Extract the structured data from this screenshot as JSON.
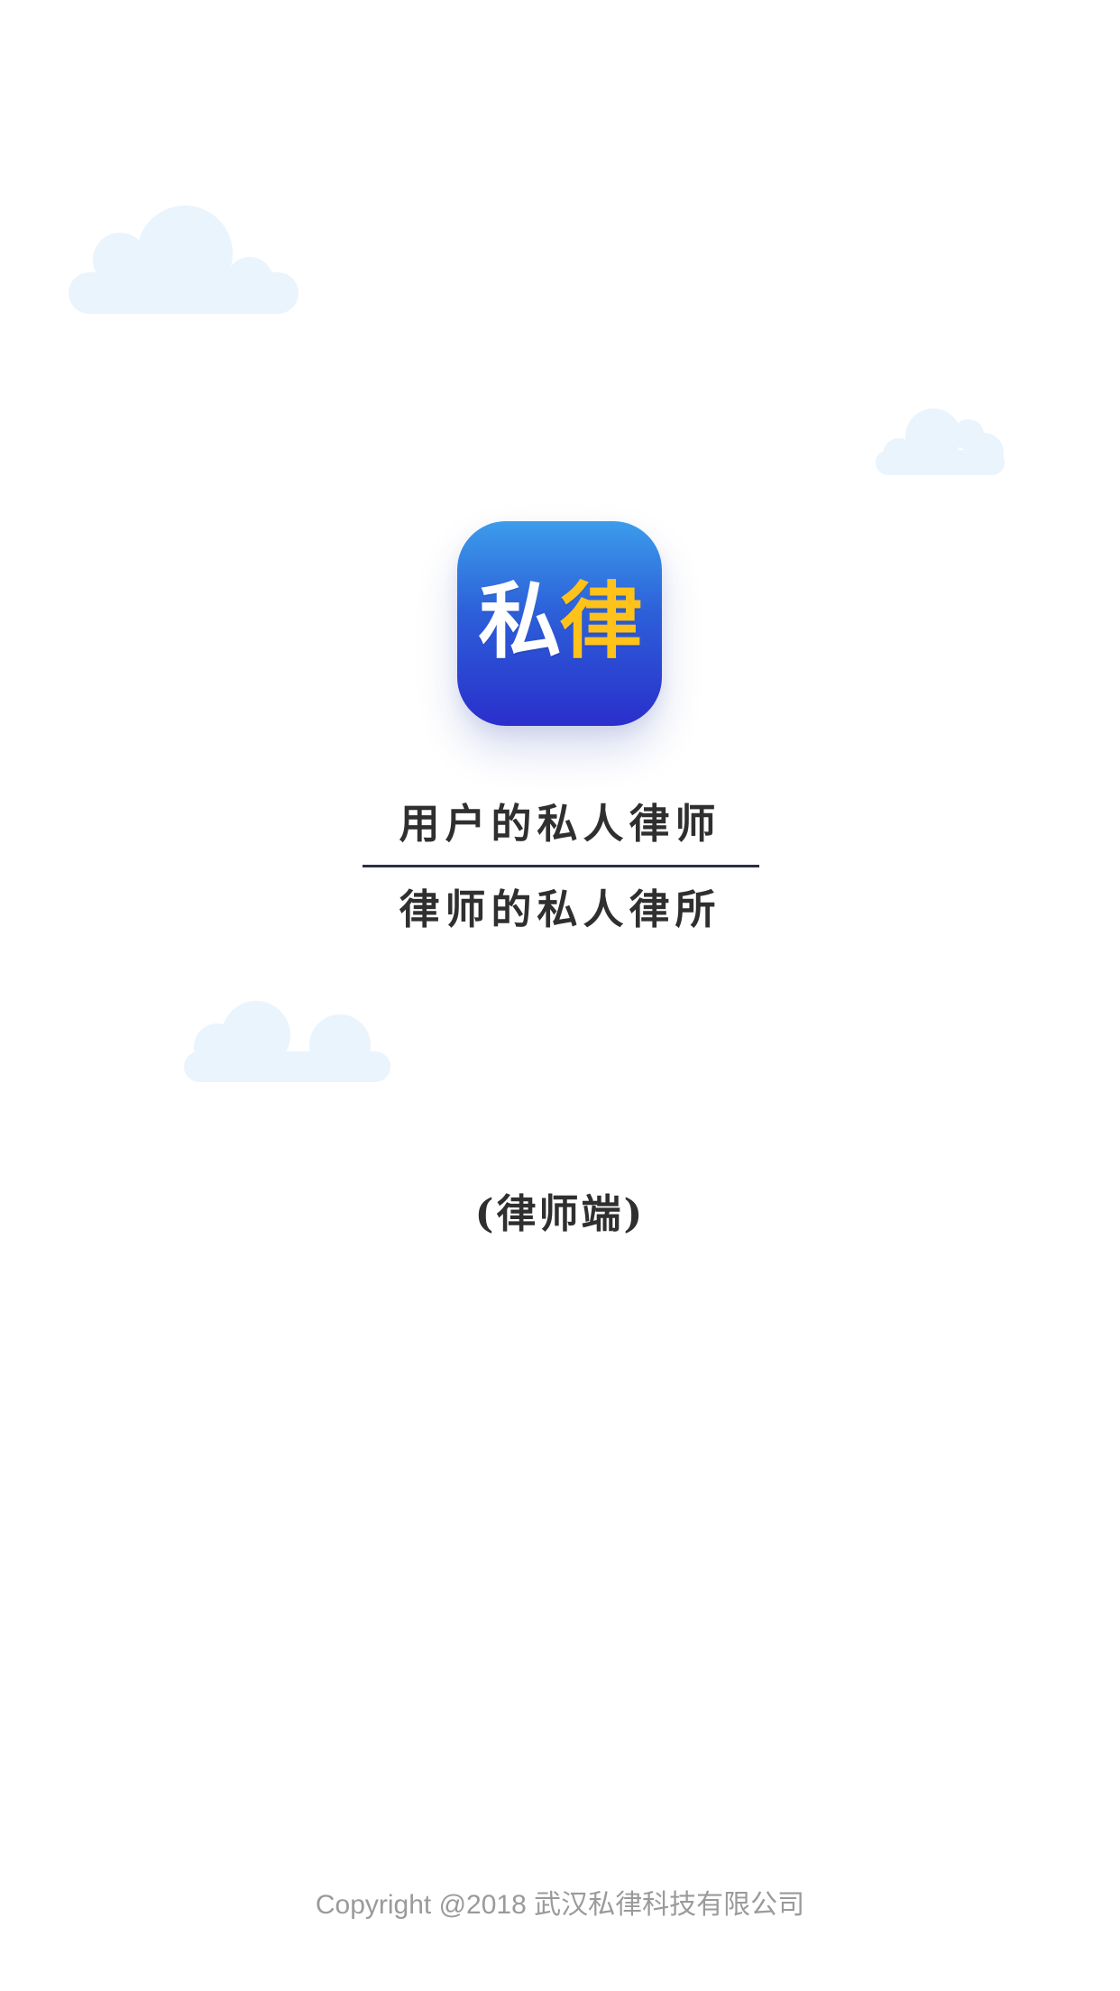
{
  "app_icon": {
    "text_main": "私",
    "text_accent": "律",
    "gradient_top": "#3C9CEB",
    "gradient_bottom": "#2A2FCC",
    "accent_color": "#FFC21A"
  },
  "slogan": {
    "line1": "用户的私人律师",
    "line2": "律师的私人律所"
  },
  "client_type": "(律师端)",
  "footer": {
    "copyright": "Copyright @2018  武汉私律科技有限公司"
  },
  "colors": {
    "background": "#ffffff",
    "cloud": "#EAF4FD",
    "text": "#2f2f2f",
    "divider": "#2b2f45",
    "footer_text": "#9a9a9a"
  },
  "icons": [
    "cloud-icon",
    "app-logo-icon"
  ]
}
